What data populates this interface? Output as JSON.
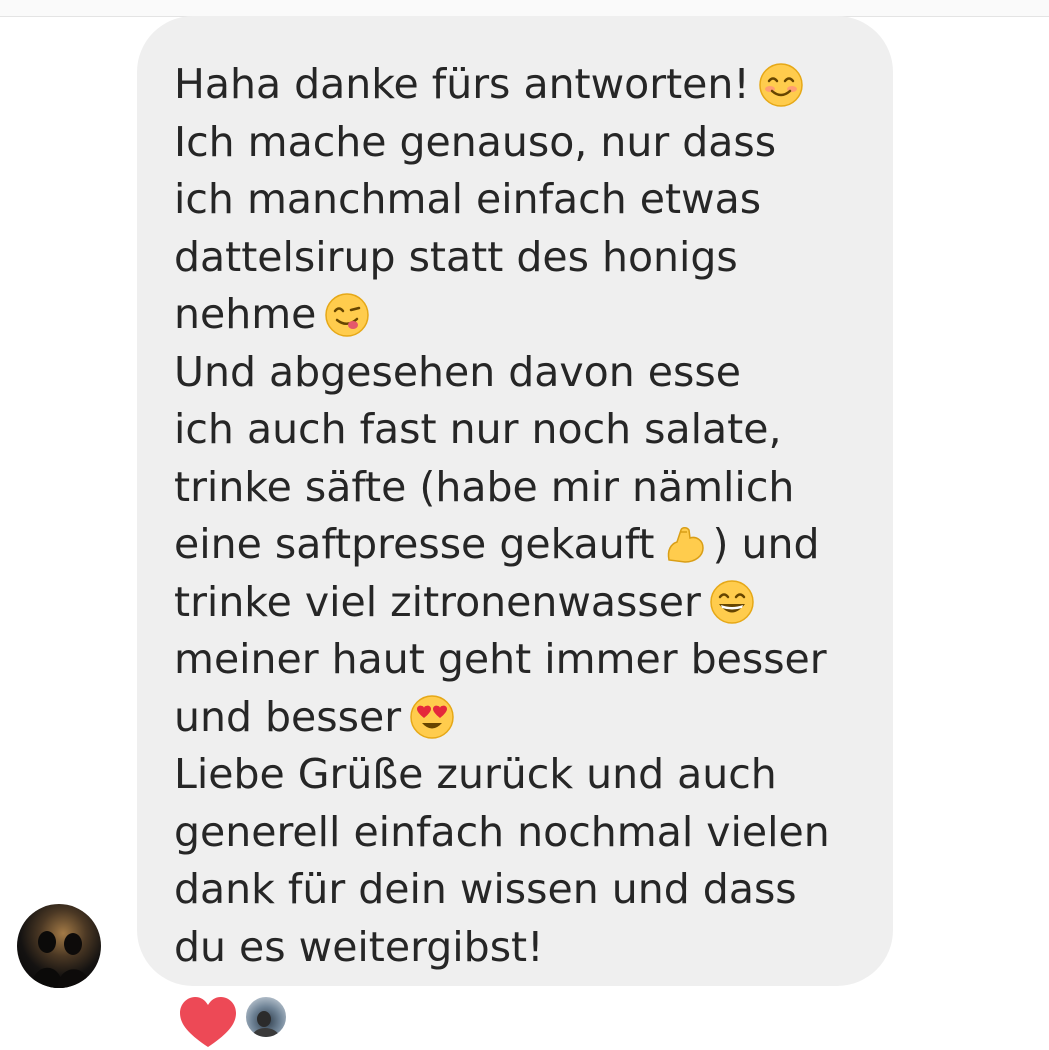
{
  "message": {
    "lines": [
      {
        "text": "Haha danke fürs antworten!",
        "emoji": "smiling-face-icon"
      },
      {
        "text": "Ich mache genauso, nur dass"
      },
      {
        "text": "ich manchmal einfach etwas"
      },
      {
        "text": "dattelsirup statt des honigs"
      },
      {
        "text": "nehme",
        "emoji": "yum-face-icon"
      },
      {
        "text": "Und abgesehen davon esse"
      },
      {
        "text": "ich auch fast nur noch salate,"
      },
      {
        "text": "trinke säfte (habe mir nämlich"
      },
      {
        "text": "eine saftpresse gekauft",
        "emoji": "flexed-biceps-icon",
        "after": ") und"
      },
      {
        "text": "trinke viel zitronenwasser",
        "emoji": "grinning-face-icon"
      },
      {
        "text": "meiner haut geht immer besser"
      },
      {
        "text": "und besser",
        "emoji": "heart-eyes-face-icon"
      },
      {
        "text": "Liebe Grüße zurück und auch"
      },
      {
        "text": "generell einfach nochmal vielen"
      },
      {
        "text": "dank für dein wissen und dass"
      },
      {
        "text": "du es weitergibst!"
      }
    ]
  },
  "colors": {
    "bubble": "#efefef",
    "text": "#262626",
    "heart": "#ed4956"
  },
  "sender": {
    "avatar_icon": "sender-avatar-icon"
  },
  "reactions": [
    {
      "icon": "heart-icon"
    },
    {
      "icon": "reactor-avatar-icon"
    }
  ]
}
